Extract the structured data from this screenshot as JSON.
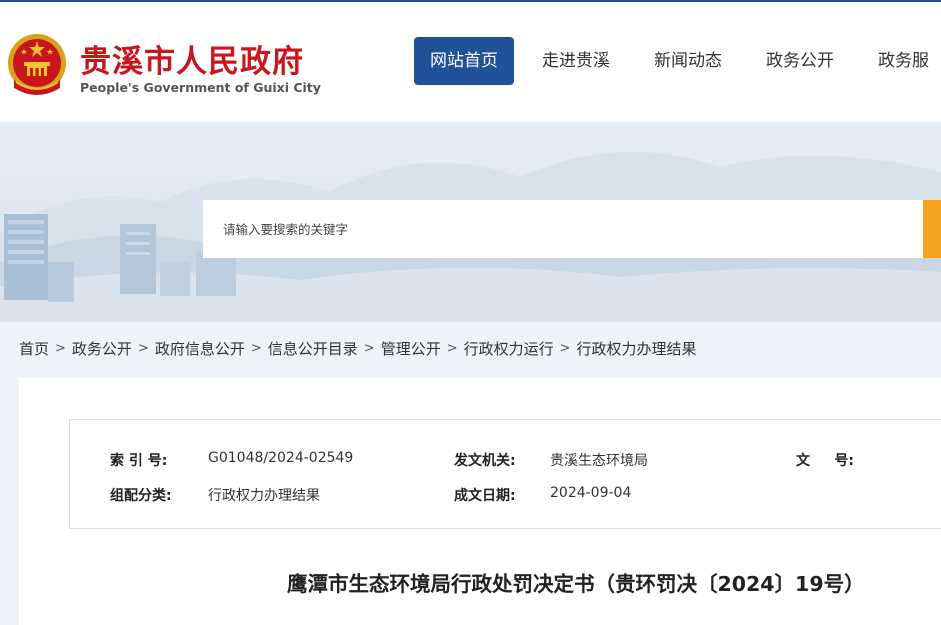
{
  "header": {
    "title": "贵溪市人民政府",
    "subtitle": "People's Government of Guixi City",
    "emblem_icon": "national-emblem-icon"
  },
  "nav": {
    "items": [
      {
        "label": "网站首页",
        "active": true
      },
      {
        "label": "走进贵溪",
        "active": false
      },
      {
        "label": "新闻动态",
        "active": false
      },
      {
        "label": "政务公开",
        "active": false
      },
      {
        "label": "政务服",
        "active": false
      }
    ]
  },
  "search": {
    "placeholder": "请输入要搜索的关键字"
  },
  "breadcrumb": {
    "items": [
      "首页",
      "政务公开",
      "政府信息公开",
      "信息公开目录",
      "管理公开",
      "行政权力运行",
      "行政权力办理结果"
    ],
    "separator": ">"
  },
  "meta": {
    "index_label": "索 引 号:",
    "index_value": "G01048/2024-02549",
    "issuer_label": "发文机关:",
    "issuer_value": "贵溪生态环境局",
    "docno_label": "文     号:",
    "docno_value": "",
    "category_label": "组配分类:",
    "category_value": "行政权力办理结果",
    "date_label": "成文日期:",
    "date_value": "2024-09-04"
  },
  "document": {
    "title": "鹰潭市生态环境局行政处罚决定书（贵环罚决〔2024〕19号）"
  },
  "colors": {
    "brand_red": "#c8161d",
    "nav_active": "#1f5299",
    "search_button": "#f5a21e"
  }
}
